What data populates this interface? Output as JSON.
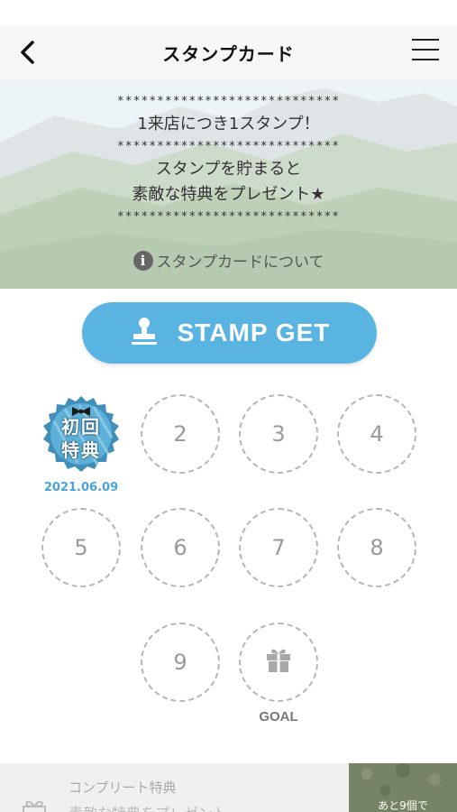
{
  "navbar": {
    "title": "スタンプカード",
    "back_icon": "chevron-left-icon",
    "menu_icon": "hamburger-menu-icon"
  },
  "hero": {
    "stars": "****************************",
    "line1": "1来店につき1スタンプ！",
    "line2": "スタンプを貯まると",
    "line3": "素敵な特典をプレゼント★",
    "about_label": "スタンプカードについて",
    "about_icon": "info-icon"
  },
  "stamp_button": {
    "label": "STAMP GET",
    "icon": "stamp-icon",
    "color": "#5ab4e2"
  },
  "stamp_card": {
    "collected": [
      {
        "label_top": "初回",
        "label_bottom": "特典",
        "date": "2021.06.09"
      }
    ],
    "slots": [
      "2",
      "3",
      "4",
      "5",
      "6",
      "7",
      "8",
      "9"
    ],
    "goal_label": "GOAL",
    "goal_icon": "gift-icon",
    "accent": "#4aa3d6"
  },
  "bottom": {
    "title": "コンプリート特典",
    "subtitle": "素敵な特典をプレゼント",
    "remaining": "あと9個で",
    "icon": "gift-outline-icon"
  }
}
